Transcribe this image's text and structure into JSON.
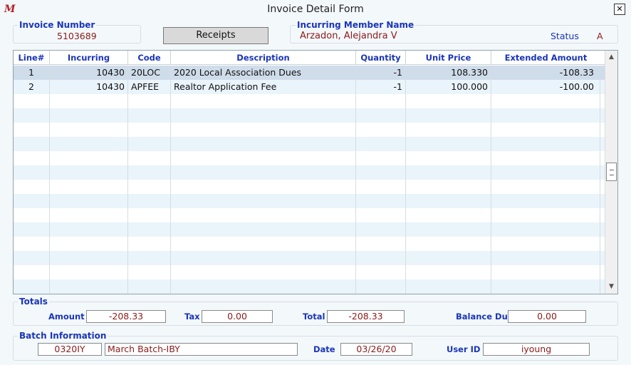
{
  "window": {
    "title": "Invoice Detail Form",
    "close_label": "✕"
  },
  "invoice": {
    "label": "Invoice Number",
    "value": "5103689"
  },
  "receipts_button": "Receipts",
  "member": {
    "label": "Incurring Member Name",
    "name": "Arzadon, Alejandra V",
    "status_label": "Status",
    "status_value": "A"
  },
  "grid": {
    "columns": [
      "Line#",
      "Incurring Member",
      "Code",
      "Description",
      "Quantity",
      "Unit Price",
      "Extended Amount"
    ],
    "rows": [
      {
        "line": "1",
        "member": "10430",
        "code": "20LOC",
        "description": "2020 Local Association Dues",
        "quantity": "-1",
        "unit_price": "108.330",
        "extended": "-108.33"
      },
      {
        "line": "2",
        "member": "10430",
        "code": "APFEE",
        "description": "Realtor Application Fee",
        "quantity": "-1",
        "unit_price": "100.000",
        "extended": "-100.00"
      }
    ]
  },
  "totals": {
    "legend": "Totals",
    "amount_label": "Amount",
    "amount": "-208.33",
    "tax_label": "Tax",
    "tax": "0.00",
    "total_label": "Total",
    "total": "-208.33",
    "balance_label": "Balance Due",
    "balance": "0.00"
  },
  "batch": {
    "legend": "Batch Information",
    "code": "0320IY",
    "name": "March Batch-IBY",
    "date_label": "Date",
    "date": "03/26/20",
    "user_label": "User ID",
    "user": "iyoung"
  },
  "colors": {
    "label_blue": "#1a35b8",
    "value_red": "#8b1a1a",
    "selected_row": "#cfdcea",
    "alt_row": "#eaf4fb"
  }
}
